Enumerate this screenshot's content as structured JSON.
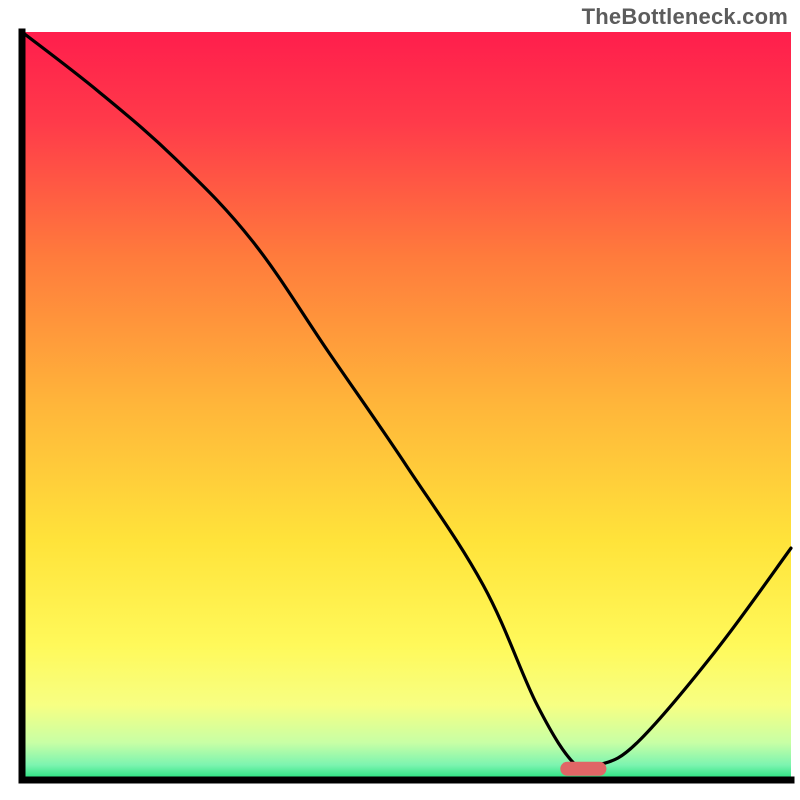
{
  "watermark": "TheBottleneck.com",
  "chart_data": {
    "type": "line",
    "title": "",
    "xlabel": "",
    "ylabel": "",
    "xlim": [
      0,
      100
    ],
    "ylim": [
      0,
      100
    ],
    "series": [
      {
        "name": "bottleneck-curve",
        "x": [
          0,
          10,
          20,
          30,
          40,
          50,
          60,
          67,
          72,
          75,
          80,
          90,
          100
        ],
        "y": [
          100,
          92,
          83,
          72,
          57,
          42,
          26,
          10,
          2,
          2,
          5,
          17,
          31
        ]
      }
    ],
    "optimal_marker": {
      "x_center": 73,
      "x_halfwidth": 3,
      "y": 1.5
    },
    "gradient_stops": [
      {
        "pct": 0,
        "color": "#ff1e4c"
      },
      {
        "pct": 12,
        "color": "#ff3a4a"
      },
      {
        "pct": 30,
        "color": "#ff7b3c"
      },
      {
        "pct": 50,
        "color": "#ffb63a"
      },
      {
        "pct": 68,
        "color": "#ffe33a"
      },
      {
        "pct": 82,
        "color": "#fff95a"
      },
      {
        "pct": 90,
        "color": "#f7ff83"
      },
      {
        "pct": 95,
        "color": "#c8ffa5"
      },
      {
        "pct": 98,
        "color": "#7cf4b0"
      },
      {
        "pct": 100,
        "color": "#1fe07a"
      }
    ],
    "colors": {
      "curve": "#000000",
      "frame": "#000000",
      "marker": "#e06666"
    }
  }
}
